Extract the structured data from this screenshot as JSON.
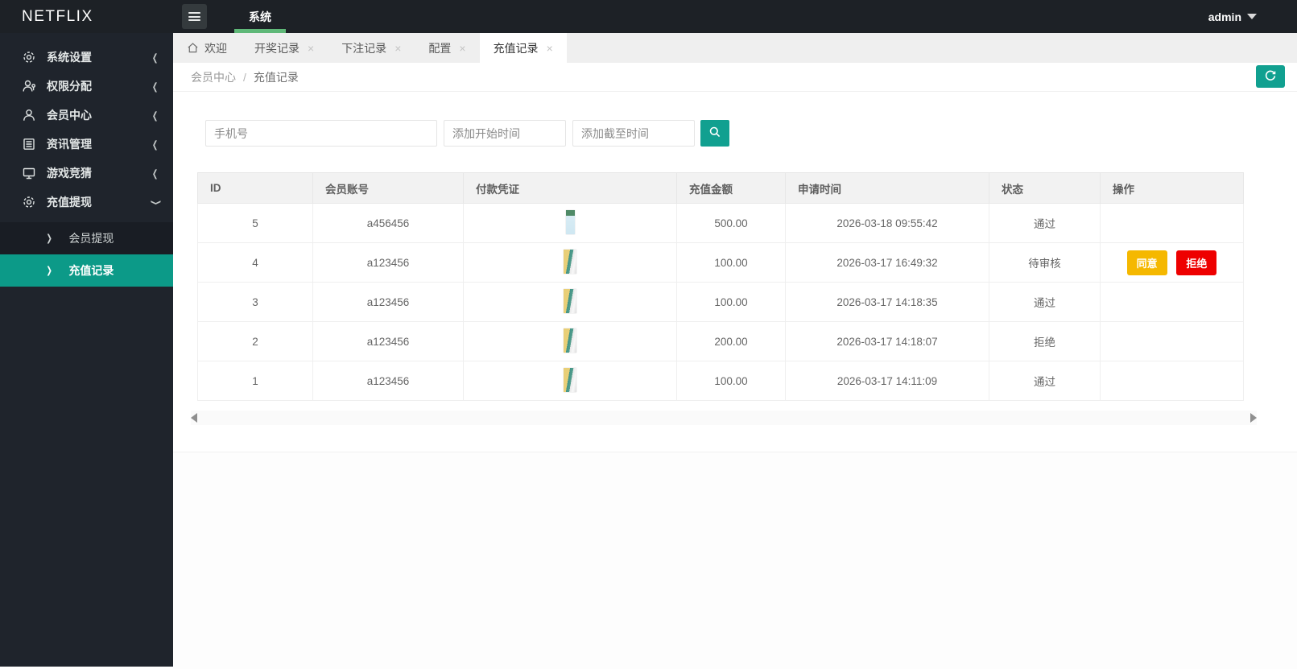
{
  "brand": "NETFLIX",
  "topbar": {
    "nav_label": "系统",
    "user": "admin"
  },
  "icons": {
    "menu": "hamburger-icon",
    "close_glyph": "×",
    "chevron_left": "❮",
    "submenu_arrow": "❯",
    "search": "magnifier-icon",
    "refresh": "refresh-icon",
    "home": "home-icon",
    "caret": "caret-down-icon"
  },
  "colors": {
    "accent_teal": "#11a090",
    "active_menu_teal": "#0c9a88",
    "tab_underline_green": "#5fb878",
    "status_pass_green": "#30b34a",
    "agree_yellow": "#f5b800",
    "refuse_red": "#ee0000"
  },
  "sidebar": {
    "items": [
      {
        "label": "系统设置",
        "icon": "gear-icon"
      },
      {
        "label": "权限分配",
        "icon": "user-key-icon"
      },
      {
        "label": "会员中心",
        "icon": "user-icon"
      },
      {
        "label": "资讯管理",
        "icon": "document-icon"
      },
      {
        "label": "游戏竞猜",
        "icon": "monitor-icon"
      },
      {
        "label": "充值提现",
        "icon": "gear-icon",
        "expanded": true
      }
    ],
    "subitems": [
      {
        "label": "会员提现",
        "active": false
      },
      {
        "label": "充值记录",
        "active": true
      }
    ]
  },
  "tabs": [
    {
      "label": "欢迎",
      "closable": false,
      "active": false
    },
    {
      "label": "开奖记录",
      "closable": true,
      "active": false
    },
    {
      "label": "下注记录",
      "closable": true,
      "active": false
    },
    {
      "label": "配置",
      "closable": true,
      "active": false
    },
    {
      "label": "充值记录",
      "closable": true,
      "active": true
    }
  ],
  "breadcrumb": {
    "parent": "会员中心",
    "separator": "/",
    "current": "充值记录"
  },
  "search": {
    "phone_placeholder": "手机号",
    "start_placeholder": "添加开始时间",
    "end_placeholder": "添加截至时间"
  },
  "table": {
    "columns": [
      "ID",
      "会员账号",
      "付款凭证",
      "充值金额",
      "申请时间",
      "状态",
      "操作"
    ],
    "rows": [
      {
        "id": "5",
        "account": "a456456",
        "voucher": "payment-screenshot",
        "amount": "500.00",
        "time": "2026-03-18 09:55:42",
        "status": "通过",
        "status_type": "pass",
        "actions": []
      },
      {
        "id": "4",
        "account": "a123456",
        "voucher": "payment-screenshot",
        "amount": "100.00",
        "time": "2026-03-17 16:49:32",
        "status": "待审核",
        "status_type": "pending",
        "actions": [
          "同意",
          "拒绝"
        ]
      },
      {
        "id": "3",
        "account": "a123456",
        "voucher": "payment-screenshot",
        "amount": "100.00",
        "time": "2026-03-17 14:18:35",
        "status": "通过",
        "status_type": "pass",
        "actions": []
      },
      {
        "id": "2",
        "account": "a123456",
        "voucher": "payment-screenshot",
        "amount": "200.00",
        "time": "2026-03-17 14:18:07",
        "status": "拒绝",
        "status_type": "reject",
        "actions": []
      },
      {
        "id": "1",
        "account": "a123456",
        "voucher": "payment-screenshot",
        "amount": "100.00",
        "time": "2026-03-17 14:11:09",
        "status": "通过",
        "status_type": "pass",
        "actions": []
      }
    ]
  }
}
